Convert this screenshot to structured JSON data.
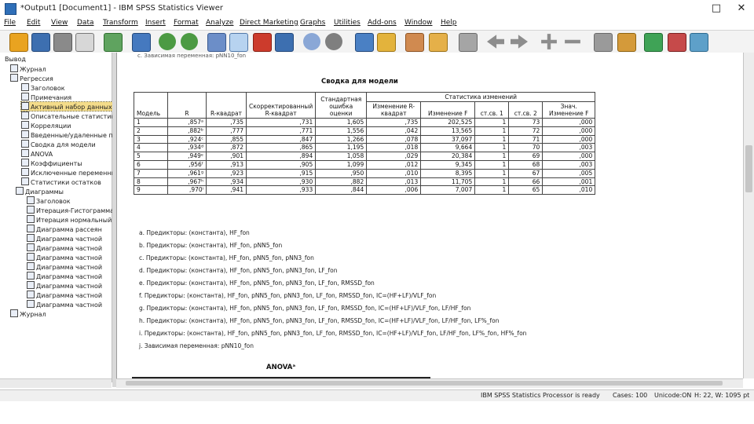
{
  "window": {
    "title": "*Output1 [Document1] - IBM SPSS Statistics Viewer",
    "controls": [
      "□",
      "✕"
    ]
  },
  "menu": [
    "File",
    "Edit",
    "View",
    "Data",
    "Transform",
    "Insert",
    "Format",
    "Analyze",
    "Direct Marketing",
    "Graphs",
    "Utilities",
    "Add-ons",
    "Window",
    "Help"
  ],
  "toolbar_icons": [
    "open-icon",
    "save-icon",
    "print-icon",
    "print-preview-icon",
    "export-icon",
    "goto-data-icon",
    "undo-icon",
    "redo-icon",
    "goto-case-icon",
    "goto-variable-icon",
    "variables-icon",
    "designated-window-icon",
    "insert-chart-icon",
    "find-icon",
    "insert-text-icon",
    "insert-title-icon",
    "insert-page-title-icon",
    "insert-heading-icon",
    "hide-icon",
    "promote-icon",
    "demote-icon",
    "expand-icon",
    "collapse-icon",
    "show-icon",
    "hide-items-icon",
    "insert-new-icon",
    "split-icon"
  ],
  "tree": {
    "items": [
      {
        "label": "Вывод",
        "indent": 0,
        "icon": false
      },
      {
        "label": "Журнал",
        "indent": 1,
        "icon": true
      },
      {
        "label": "Регрессия",
        "indent": 1,
        "icon": true
      },
      {
        "label": "Заголовок",
        "indent": 3,
        "icon": true
      },
      {
        "label": "Примечания",
        "indent": 3,
        "icon": true
      },
      {
        "label": "Активный набор данных",
        "indent": 3,
        "icon": true,
        "selected": true
      },
      {
        "label": "Описательные статистики",
        "indent": 3,
        "icon": true
      },
      {
        "label": "Корреляции",
        "indent": 3,
        "icon": true
      },
      {
        "label": "Введенные/удаленные пе",
        "indent": 3,
        "icon": true
      },
      {
        "label": "Сводка для модели",
        "indent": 3,
        "icon": true
      },
      {
        "label": "ANOVA",
        "indent": 3,
        "icon": true
      },
      {
        "label": "Коэффициенты",
        "indent": 3,
        "icon": true
      },
      {
        "label": "Исключенные переменные",
        "indent": 3,
        "icon": true
      },
      {
        "label": "Статистики остатков",
        "indent": 3,
        "icon": true
      },
      {
        "label": "Диаграммы",
        "indent": 2,
        "icon": true
      },
      {
        "label": "Заголовок",
        "indent": 4,
        "icon": true
      },
      {
        "label": "Итерация-Гистограмма",
        "indent": 4,
        "icon": true
      },
      {
        "label": "Итерация нормальный",
        "indent": 4,
        "icon": true
      },
      {
        "label": "Диаграмма рассеян",
        "indent": 4,
        "icon": true
      },
      {
        "label": "Диаграмма частной",
        "indent": 4,
        "icon": true
      },
      {
        "label": "Диаграмма частной",
        "indent": 4,
        "icon": true
      },
      {
        "label": "Диаграмма частной",
        "indent": 4,
        "icon": true
      },
      {
        "label": "Диаграмма частной",
        "indent": 4,
        "icon": true
      },
      {
        "label": "Диаграмма частной",
        "indent": 4,
        "icon": true
      },
      {
        "label": "Диаграмма частной",
        "indent": 4,
        "icon": true
      },
      {
        "label": "Диаграмма частной",
        "indent": 4,
        "icon": true
      },
      {
        "label": "Диаграмма частной",
        "indent": 4,
        "icon": true
      },
      {
        "label": "Журнал",
        "indent": 1,
        "icon": true
      }
    ]
  },
  "output": {
    "table_title": "Сводка для модели",
    "headers": {
      "model": "Модель",
      "r": "R",
      "r2": "R-квадрат",
      "adj_r2": "Скорректированный R-квадрат",
      "se": "Стандартная ошибка оценки",
      "change_group": "Статистика изменений",
      "r2_change": "Изменение R-квадрат",
      "f_change": "Изменение F",
      "df1": "ст.св. 1",
      "df2": "ст.св. 2",
      "sig_change": "Знач. Изменение F"
    },
    "rows": [
      [
        "1",
        ",857ᵃ",
        ",735",
        ",731",
        "1,605",
        ",735",
        "202,525",
        "1",
        "73",
        ",000"
      ],
      [
        "2",
        ",882ᵇ",
        ",777",
        ",771",
        "1,556",
        ",042",
        "13,565",
        "1",
        "72",
        ",000"
      ],
      [
        "3",
        ",924ᶜ",
        ",855",
        ",847",
        "1,266",
        ",078",
        "37,097",
        "1",
        "71",
        ",000"
      ],
      [
        "4",
        ",934ᵈ",
        ",872",
        ",865",
        "1,195",
        ",018",
        "9,664",
        "1",
        "70",
        ",003"
      ],
      [
        "5",
        ",949ᵉ",
        ",901",
        ",894",
        "1,058",
        ",029",
        "20,384",
        "1",
        "69",
        ",000"
      ],
      [
        "6",
        ",956ᶠ",
        ",913",
        ",905",
        "1,099",
        ",012",
        "9,345",
        "1",
        "68",
        ",003"
      ],
      [
        "7",
        ",961ᵍ",
        ",923",
        ",915",
        ",950",
        ",010",
        "8,395",
        "1",
        "67",
        ",005"
      ],
      [
        "8",
        ",967ʰ",
        ",934",
        ",930",
        ",882",
        ",013",
        "11,705",
        "1",
        "66",
        ",001"
      ],
      [
        "9",
        ",970ⁱ",
        ",941",
        ",933",
        ",844",
        ",006",
        "7,007",
        "1",
        "65",
        ",010"
      ]
    ],
    "footnotes": [
      "a. Предикторы: (константа), HF_fon",
      "b. Предикторы: (константа), HF_fon, pNN5_fon",
      "c. Предикторы: (константа), HF_fon, pNN5_fon, pNN3_fon",
      "d. Предикторы: (константа), HF_fon, pNN5_fon, pNN3_fon, LF_fon",
      "e. Предикторы: (константа), HF_fon, pNN5_fon, pNN3_fon, LF_fon, RMSSD_fon",
      "f. Предикторы: (константа), HF_fon, pNN5_fon, pNN3_fon, LF_fon, RMSSD_fon, IC=(HF+LF)/VLF_fon",
      "g. Предикторы: (константа), HF_fon, pNN5_fon, pNN3_fon, LF_fon, RMSSD_fon, IC=(HF+LF)/VLF_fon, LF/HF_fon",
      "h. Предикторы: (константа), HF_fon, pNN5_fon, pNN3_fon, LF_fon, RMSSD_fon, IC=(HF+LF)/VLF_fon, LF/HF_fon, LF%_fon",
      "i. Предикторы: (константа), HF_fon, pNN5_fon, pNN3_fon, LF_fon, RMSSD_fon, IC=(HF+LF)/VLF_fon, LF/HF_fon, LF%_fon, HF%_fon",
      "j. Зависимая переменная: pNN10_fon"
    ],
    "anova_title": "ANOVAᵃ"
  },
  "status": {
    "processor": "IBM SPSS Statistics Processor is ready",
    "cases": "Cases: 100",
    "unicode": "Unicode:ON",
    "size": "H: 22, W: 1095 pt"
  },
  "colors": {
    "selection": "#f4dc8a",
    "icon_blue": "#2f6fb8",
    "toolbar_bg": "#f3f3f3"
  }
}
